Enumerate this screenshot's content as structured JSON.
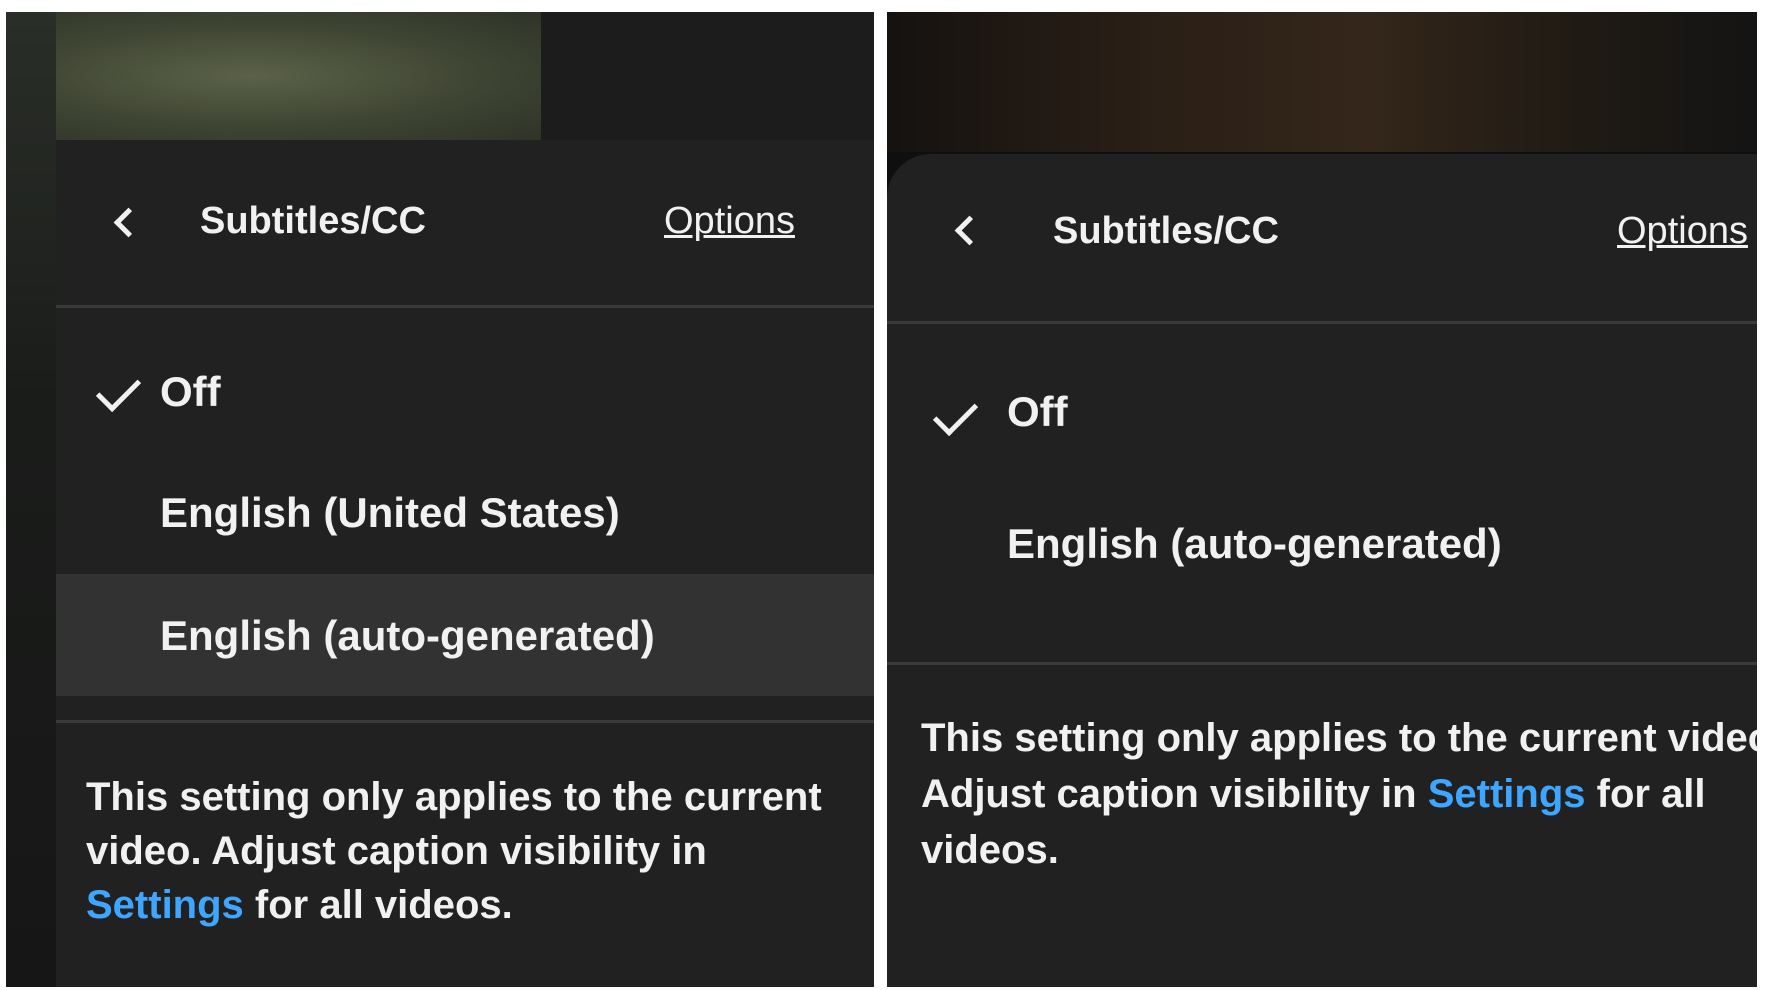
{
  "left": {
    "header": {
      "title": "Subtitles/CC",
      "options_link": "Options"
    },
    "items": [
      {
        "label": "Off",
        "checked": true
      },
      {
        "label": "English (United States)",
        "checked": false
      },
      {
        "label": "English (auto-generated)",
        "checked": false,
        "highlighted": true
      }
    ],
    "note": {
      "line1": "This setting only applies to the current",
      "line2": "video. Adjust caption visibility in",
      "line3_link": "Settings",
      "line3_rest": " for all videos."
    }
  },
  "right": {
    "header": {
      "title": "Subtitles/CC",
      "options_link": "Options"
    },
    "items": [
      {
        "label": "Off",
        "checked": true
      },
      {
        "label": "English (auto-generated)",
        "checked": false
      }
    ],
    "note": {
      "line1": "This setting only applies to the current video.",
      "line2_pre": "Adjust caption visibility in ",
      "line2_link": "Settings",
      "line2_post": " for all",
      "line3": "videos."
    }
  },
  "colors": {
    "sheet": "#212121",
    "highlight": "#323232",
    "text": "#f1f1f1",
    "link": "#3ea6ff",
    "divider": "#3a3a3a"
  }
}
